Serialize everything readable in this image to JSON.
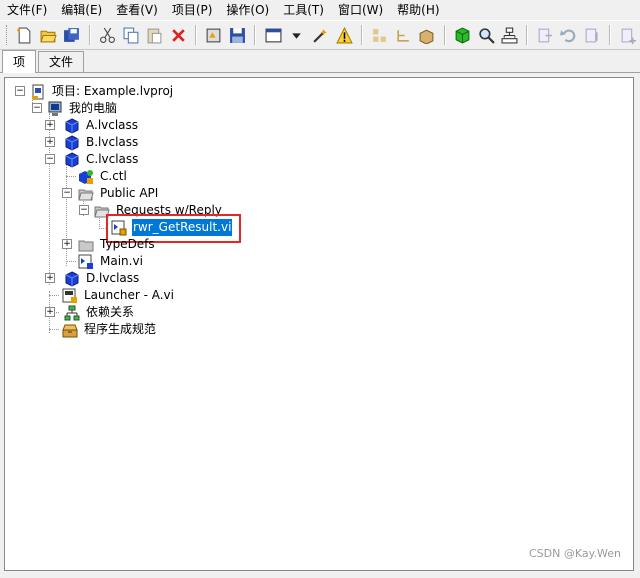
{
  "menu": [
    "文件(F)",
    "编辑(E)",
    "查看(V)",
    "项目(P)",
    "操作(O)",
    "工具(T)",
    "窗口(W)",
    "帮助(H)"
  ],
  "tabs": [
    "项",
    "文件"
  ],
  "tree": {
    "project": "项目: Example.lvproj",
    "my_computer": "我的电脑",
    "a_class": "A.lvclass",
    "b_class": "B.lvclass",
    "c_class": "C.lvclass",
    "c_ctl": "C.ctl",
    "public_api": "Public API",
    "requests": "Requests w/Reply",
    "rwr_vi": "rwr_GetResult.vi",
    "typedefs": "TypeDefs",
    "main_vi": "Main.vi",
    "d_class": "D.lvclass",
    "launcher": "Launcher - A.vi",
    "deps": "依赖关系",
    "build": "程序生成规范"
  },
  "watermark": "CSDN @Kay.Wen",
  "colors": {
    "selection": "#0078d7",
    "highlight_border": "#e32626",
    "class_icon": "#1a3fd6"
  }
}
